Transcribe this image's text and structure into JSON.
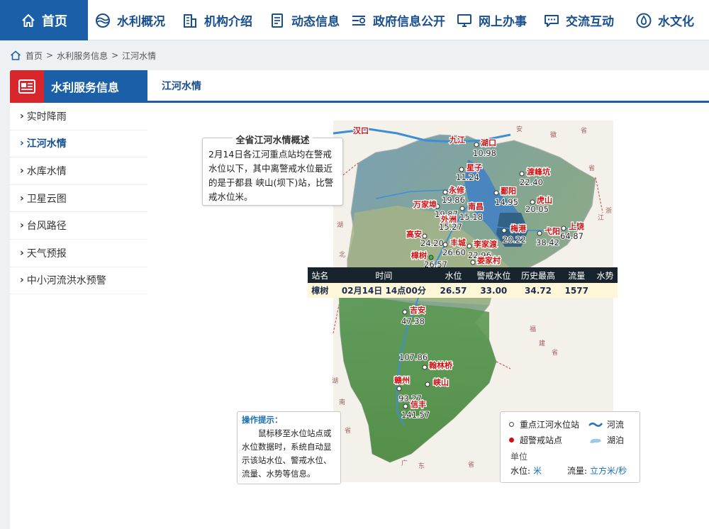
{
  "nav": {
    "home": "首页",
    "items": [
      "水利概况",
      "机构介绍",
      "动态信息",
      "政府信息公开",
      "网上办事",
      "交流互动",
      "水文化"
    ]
  },
  "breadcrumb": [
    "首页",
    "水利服务信息",
    "江河水情"
  ],
  "sidebar": {
    "title": "水利服务信息",
    "items": [
      "实时降雨",
      "江河水情",
      "水库水情",
      "卫星云图",
      "台风路径",
      "天气预报",
      "中小河流洪水预警"
    ],
    "active_index": 1
  },
  "tab": {
    "label": "江河水情"
  },
  "summary": {
    "title": "全省江河水情概述",
    "text": "2月14日各江河重点站均在警戒水位以下，其中离警戒水位最近的是于都县 峡山(坝下)站，比警戒水位米。"
  },
  "map": {
    "stations": [
      {
        "name": "汉口",
        "value": ""
      },
      {
        "name": "九江",
        "value": ""
      },
      {
        "name": "湖口",
        "value": "10.98"
      },
      {
        "name": "星子",
        "value": "11.24"
      },
      {
        "name": "渡峰坑",
        "value": "22.40"
      },
      {
        "name": "永修",
        "value": "19.86"
      },
      {
        "name": "鄱阳",
        "value": "14.95"
      },
      {
        "name": "虎山",
        "value": "20.05"
      },
      {
        "name": "万家埠",
        "value": "19.87"
      },
      {
        "name": "南昌",
        "value": "15.18"
      },
      {
        "name": "外洲",
        "value": "15.27"
      },
      {
        "name": "梅港",
        "value": "20.22"
      },
      {
        "name": "弋阳",
        "value": "38.42"
      },
      {
        "name": "上饶",
        "value": "64.87"
      },
      {
        "name": "高安",
        "value": "24.20"
      },
      {
        "name": "丰城",
        "value": "26.60"
      },
      {
        "name": "李家渡",
        "value": "22.96"
      },
      {
        "name": "樟树",
        "value": "26.57"
      },
      {
        "name": "娄家村",
        "value": ""
      },
      {
        "name": "吉安",
        "value": "47.38"
      },
      {
        "name": "翰林桥",
        "value": "107.86"
      },
      {
        "name": "赣州",
        "value": "93.27"
      },
      {
        "name": "峡山",
        "value": ""
      },
      {
        "name": "信丰",
        "value": "141.57"
      }
    ],
    "province_marks": [
      "安",
      "徽",
      "省",
      "省",
      "浙",
      "江",
      "湖",
      "北",
      "省",
      "福",
      "建",
      "省",
      "湖",
      "南",
      "省",
      "广",
      "东",
      "省"
    ]
  },
  "station_table": {
    "headers": [
      "站名",
      "时间",
      "水位",
      "警戒水位",
      "历史最高",
      "流量",
      "水势"
    ],
    "row": [
      "樟树",
      "02月14日 14点00分",
      "26.57",
      "33.00",
      "34.72",
      "1577",
      ""
    ]
  },
  "tips": {
    "title": "操作提示：",
    "text": "鼠标移至水位站点或水位数据时，系统自动显示该站水位、警戒水位、流量、水势等信息。"
  },
  "legend": {
    "key_station": "重点江河水位站",
    "over_warning": "超警戒站点",
    "river": "河流",
    "lake": "湖泊",
    "unit_title": "单位",
    "water_level_label": "水位:",
    "water_level_unit": "米",
    "flow_label": "流量:",
    "flow_unit": "立方米/秒"
  },
  "colors": {
    "nav_blue": "#1a5fa8",
    "sidebar_red": "#d7262c",
    "station_red": "#d01010",
    "table_header": "#17242d",
    "table_row": "#fdf7d7"
  }
}
